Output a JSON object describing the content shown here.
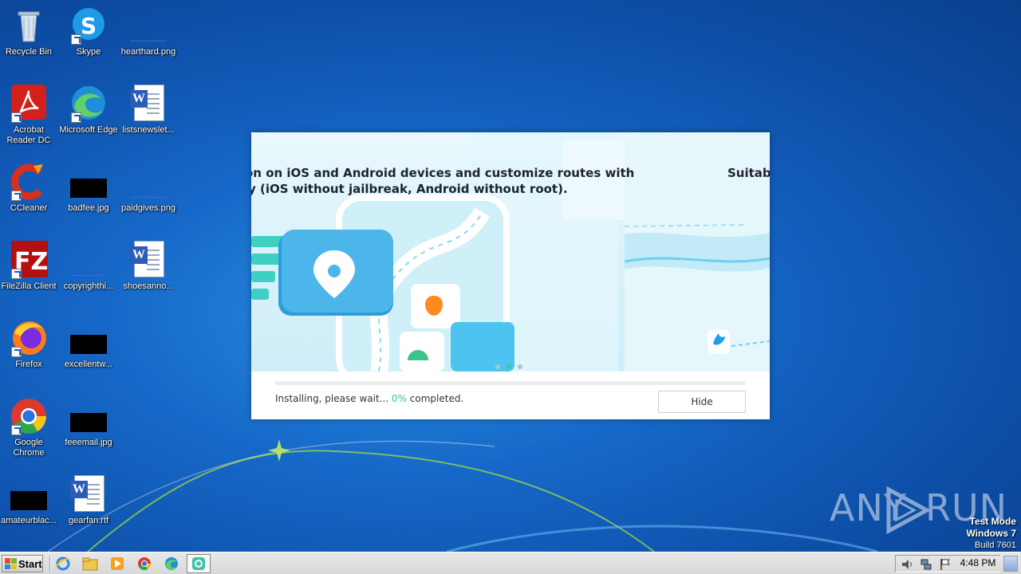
{
  "desktop": {
    "icons": [
      {
        "label": "Recycle Bin"
      },
      {
        "label": "Skype"
      },
      {
        "label": "hearthard.png"
      },
      {
        "label": "Acrobat Reader DC"
      },
      {
        "label": "Microsoft Edge"
      },
      {
        "label": "listsnewslet..."
      },
      {
        "label": "CCleaner"
      },
      {
        "label": "badfee.jpg"
      },
      {
        "label": "paidgives.png"
      },
      {
        "label": "FileZilla Client"
      },
      {
        "label": "copyrighthi..."
      },
      {
        "label": "shoesanno..."
      },
      {
        "label": "Firefox"
      },
      {
        "label": "excellentw..."
      },
      {
        "label": "Google Chrome"
      },
      {
        "label": "feeemail.jpg"
      },
      {
        "label": "amateurblac..."
      },
      {
        "label": "gearfan.rtf"
      }
    ]
  },
  "installer": {
    "banner_line1": "on on iOS and Android devices and customize routes with",
    "banner_line2": "y (iOS without jailbreak, Android without root).",
    "banner_line3": "Suitabl",
    "status_prefix": "Installing, please wait... ",
    "progress_percent": "0%",
    "status_suffix": " completed.",
    "progress_value": 0,
    "hide_label": "Hide",
    "carousel_total": 3,
    "carousel_active": 2,
    "accent_color": "#3bc3a4"
  },
  "watermark": {
    "brand_left": "ANY",
    "brand_right": "RUN",
    "test_mode": "Test Mode",
    "os": "Windows 7",
    "build": "Build 7601"
  },
  "taskbar": {
    "start_label": "Start",
    "clock": "4:48 PM",
    "pinned": [
      "internet-explorer-icon",
      "file-explorer-icon",
      "media-player-icon",
      "chrome-icon",
      "edge-icon",
      "installer-app-icon"
    ]
  }
}
